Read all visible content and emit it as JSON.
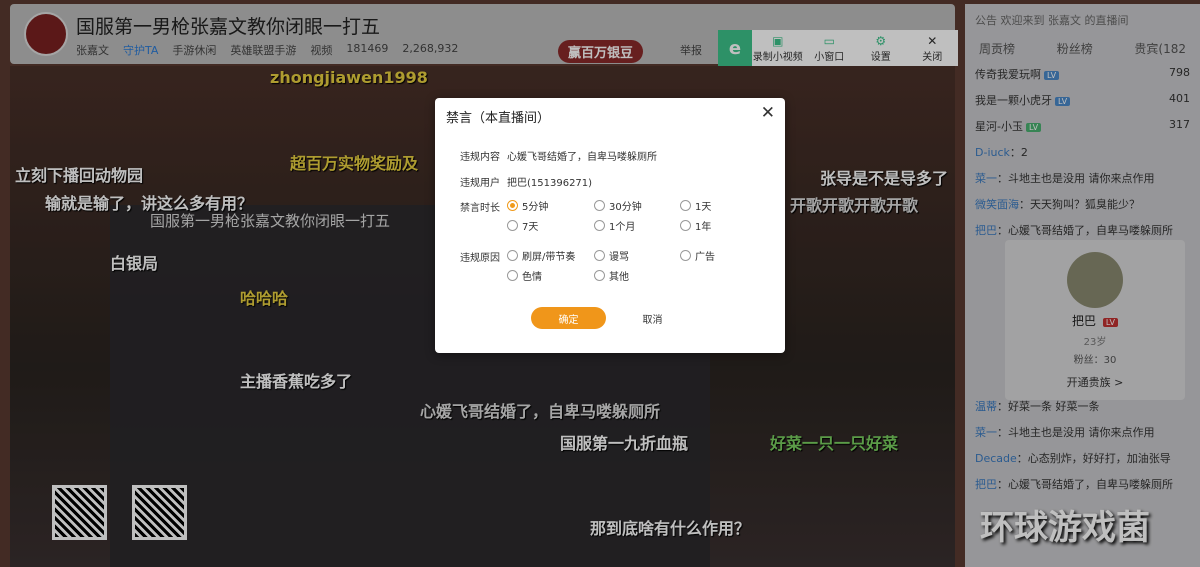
{
  "header": {
    "title": "国服第一男枪张嘉文教你闭眼一打五",
    "streamer": "张嘉文",
    "guard": "守护TA",
    "category1": "手游休闲",
    "category2": "英雄联盟手游",
    "video": "视频",
    "room_id": "181469",
    "subscribers": "2,268,932",
    "silver_bean": "赢百万银豆",
    "report": "举报"
  },
  "toolbar": {
    "logo": "e",
    "items": [
      {
        "icon": "video-record-icon",
        "label": "录制小视频"
      },
      {
        "icon": "tv-icon",
        "label": "小窗口"
      },
      {
        "icon": "gear-icon",
        "label": "设置"
      },
      {
        "icon": "close-icon",
        "label": "关闭"
      }
    ]
  },
  "danmaku": [
    "zhongjiawen1998",
    "国服第一九折血瓶",
    "心媛飞哥结婚了，自卑马喽躲厕所",
    "张导是不是导多了",
    "输就是输了，讲这么多有用？",
    "好菜一只一只好菜",
    "开歌开歌开歌开歌",
    "超百万实物奖励及",
    "立刻下播回动物园",
    "主播香蕉吃多了",
    "那到底啥有什么作用？",
    "白银局",
    "哈哈哈"
  ],
  "inner_title": "国服第一男枪张嘉文教你闭眼一打五",
  "right": {
    "notice": "公告  欢迎来到 张嘉文 的直播间",
    "tabs": [
      "周贡榜",
      "粉丝榜",
      "贵宾(182"
    ],
    "ranks": [
      {
        "name": "传奇我爱玩啊",
        "score": "798"
      },
      {
        "name": "我是一颗小虎牙",
        "score": "401"
      },
      {
        "name": "星河-小玉",
        "score": "317"
      }
    ],
    "chat": [
      {
        "user": "D-iuck",
        "text": "2"
      },
      {
        "user": "菜一",
        "text": "斗地主也是没用 请你来点作用"
      },
      {
        "user": "微笑面海",
        "text": "天天狗叫？狐臭能少？"
      },
      {
        "user": "把巴",
        "text": "心媛飞哥结婚了，自卑马喽躲厕所"
      },
      {
        "user": "温蒂",
        "text": "好菜一条 好菜一条"
      },
      {
        "user": "菜一",
        "text": "斗地主也是没用 请你来点作用"
      },
      {
        "user": "Decade",
        "text": "心态别炸，好好打，加油张导"
      },
      {
        "user": "把巴",
        "text": "心媛飞哥结婚了，自卑马喽躲厕所"
      }
    ],
    "card": {
      "name": "把巴",
      "age": "23岁",
      "fans_label": "粉丝：",
      "fans": "30",
      "noble": "开通贵族 >"
    }
  },
  "watermark": "环球游戏菌",
  "dialog": {
    "title": "禁言（本直播间）",
    "content_label": "违规内容",
    "content": "心媛飞哥结婚了，自卑马喽躲厕所",
    "user_label": "违规用户",
    "user": "把巴(151396271)",
    "duration_label": "禁言时长",
    "durations": [
      "5分钟",
      "30分钟",
      "1天",
      "7天",
      "1个月",
      "1年"
    ],
    "selected_duration": "5分钟",
    "reason_label": "违规原因",
    "reasons": [
      "刷屏/带节奏",
      "谩骂",
      "广告",
      "色情",
      "其他"
    ],
    "confirm": "确定",
    "cancel": "取消"
  },
  "colors": {
    "accent": "#f0961a",
    "toolbar_green": "#3cc28a"
  }
}
